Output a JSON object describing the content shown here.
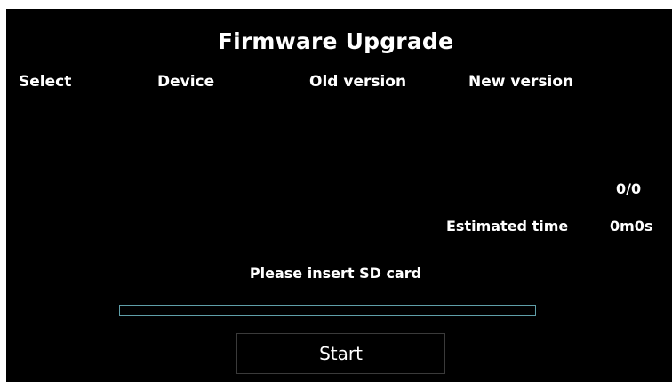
{
  "title": "Firmware Upgrade",
  "columns": {
    "select": "Select",
    "device": "Device",
    "old_version": "Old version",
    "new_version": "New version"
  },
  "rows": [],
  "count": "0/0",
  "estimated_time": {
    "label": "Estimated time",
    "value": "0m0s"
  },
  "status": "Please insert SD card",
  "progress": {
    "fraction": 0
  },
  "start_button": {
    "label": "Start"
  },
  "colors": {
    "background": "#000000",
    "text": "#ffffff",
    "progress_border": "#5f9ea8",
    "button_border": "#3a3a3a"
  }
}
